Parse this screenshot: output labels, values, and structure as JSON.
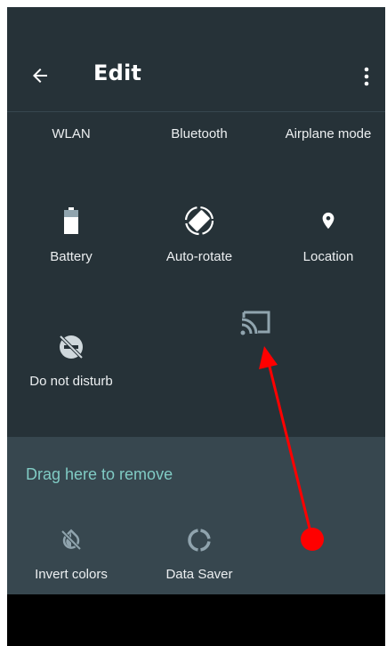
{
  "header": {
    "title": "Edit",
    "back_icon": "arrow-back-icon",
    "menu_icon": "more-vert-icon"
  },
  "active_tiles": [
    {
      "label": "WLAN",
      "icon": "wifi-icon"
    },
    {
      "label": "Bluetooth",
      "icon": "bluetooth-icon"
    },
    {
      "label": "Airplane mode",
      "icon": "airplane-icon"
    },
    {
      "label": "Battery",
      "icon": "battery-icon"
    },
    {
      "label": "Auto-rotate",
      "icon": "auto-rotate-icon"
    },
    {
      "label": "Location",
      "icon": "location-icon"
    },
    {
      "label": "Do not disturb",
      "icon": "do-not-disturb-icon"
    }
  ],
  "dragging_tile": {
    "label": "",
    "icon": "cast-icon"
  },
  "remove_area": {
    "label": "Drag here to remove",
    "tiles": [
      {
        "label": "Invert colors",
        "icon": "invert-colors-icon"
      },
      {
        "label": "Data Saver",
        "icon": "data-saver-icon"
      }
    ]
  },
  "annotation": {
    "type": "drag-arrow",
    "color": "#ff0000"
  },
  "colors": {
    "background": "#263238",
    "remove_area": "#37474f",
    "accent": "#80cbc4"
  }
}
